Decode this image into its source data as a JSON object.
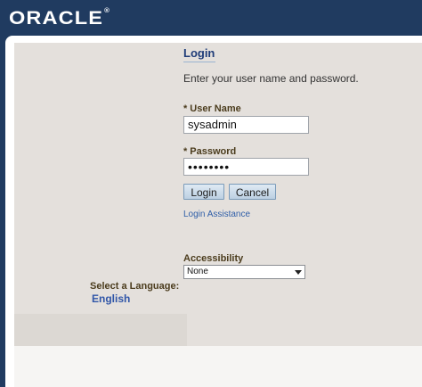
{
  "header": {
    "brand": "ORACLE",
    "brand_mark": "®"
  },
  "login": {
    "title": "Login",
    "instructions": "Enter your user name and password.",
    "required_marker": "*",
    "username_label": "User Name",
    "username_value": "sysadmin",
    "password_label": "Password",
    "password_value": "••••••••",
    "login_button": "Login",
    "cancel_button": "Cancel",
    "assistance_link": "Login Assistance"
  },
  "accessibility": {
    "label": "Accessibility",
    "selected": "None"
  },
  "language": {
    "label": "Select a Language:",
    "option": "English"
  },
  "colors": {
    "header_bg": "#203b60",
    "panel_bg": "#e4e0dc",
    "label_brown": "#4b3c1d",
    "link_blue": "#2f5ea8",
    "title_blue": "#1f3c78"
  }
}
